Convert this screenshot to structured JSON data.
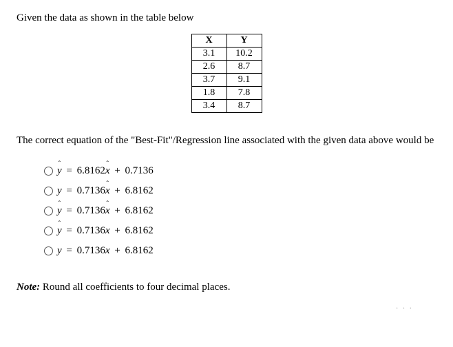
{
  "intro": "Given the data as shown in the table below",
  "table": {
    "headers": [
      "X",
      "Y"
    ],
    "rows": [
      [
        "3.1",
        "10.2"
      ],
      [
        "2.6",
        "8.7"
      ],
      [
        "3.7",
        "9.1"
      ],
      [
        "1.8",
        "7.8"
      ],
      [
        "3.4",
        "8.7"
      ]
    ]
  },
  "question": "The correct equation of the \"Best-Fit\"/Regression line associated with the given data above would be",
  "choices": [
    {
      "lhs": "ŷ",
      "slope": "6.8162",
      "xvar": "x̂",
      "intercept": "0.7136"
    },
    {
      "lhs": "y",
      "slope": "0.7136",
      "xvar": "x̂",
      "intercept": "6.8162"
    },
    {
      "lhs": "ŷ",
      "slope": "0.7136",
      "xvar": "x̂",
      "intercept": "6.8162"
    },
    {
      "lhs": "ŷ",
      "slope": "0.7136",
      "xvar": "x",
      "intercept": "6.8162"
    },
    {
      "lhs": "y",
      "slope": "0.7136",
      "xvar": "x",
      "intercept": "6.8162"
    }
  ],
  "note_label": "Note:",
  "note_text": " Round all coefficients to four decimal places.",
  "symbols": {
    "plus": "+",
    "equals": "="
  },
  "chart_data": {
    "type": "table",
    "columns": [
      "X",
      "Y"
    ],
    "rows": [
      [
        3.1,
        10.2
      ],
      [
        2.6,
        8.7
      ],
      [
        3.7,
        9.1
      ],
      [
        1.8,
        7.8
      ],
      [
        3.4,
        8.7
      ]
    ],
    "title": "",
    "xlabel": "X",
    "ylabel": "Y"
  }
}
